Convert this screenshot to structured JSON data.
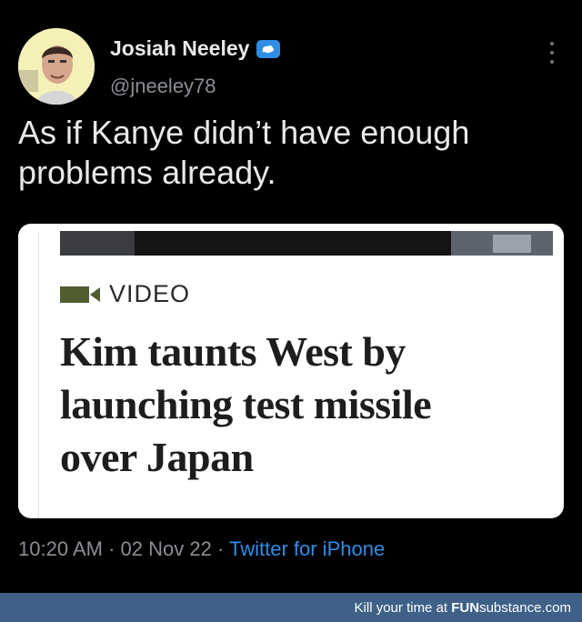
{
  "tweet": {
    "author_name": "Josiah Neeley",
    "handle": "@jneeley78",
    "badge_icon": "antarctica-flag-icon",
    "text_line1": "As if Kanye didn’t have enough",
    "text_line2": "problems already.",
    "time": "10:20 AM",
    "separator1": "·",
    "date": "02 Nov 22",
    "separator2": "·",
    "source": "Twitter for iPhone"
  },
  "card": {
    "video_label": "VIDEO",
    "video_icon": "video-camera-icon",
    "headline_line1": "Kim taunts West by",
    "headline_line2": "launching test missile",
    "headline_line3": "over Japan"
  },
  "footer": {
    "prefix": "Kill your time at",
    "brand_bold": "FUN",
    "brand_rest": "substance",
    "brand_suffix": ".com"
  },
  "colors": {
    "background": "#000000",
    "accent_blue": "#2f8de6",
    "footer_bar": "#3f6187",
    "video_icon": "#4f5d2f"
  }
}
